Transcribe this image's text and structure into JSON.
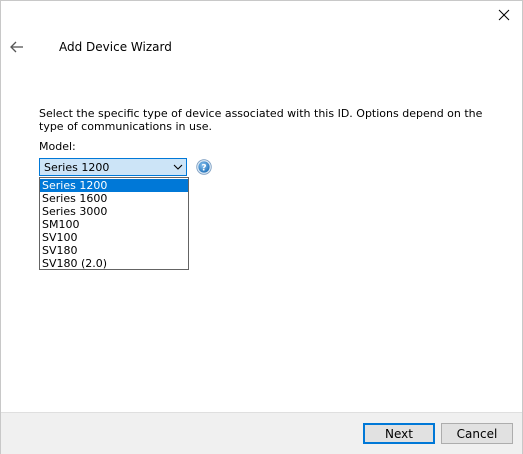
{
  "window": {
    "title": "Add Device Wizard"
  },
  "content": {
    "instructions": "Select the specific type of device associated with this ID. Options depend on the type of communications in use.",
    "model_label": "Model:",
    "model_select": {
      "value": "Series 1200",
      "options": [
        "Series 1200",
        "Series 1600",
        "Series 3000",
        "SM100",
        "SV100",
        "SV180",
        "SV180 (2.0)"
      ],
      "selected_index": 0
    }
  },
  "footer": {
    "next_label": "Next",
    "cancel_label": "Cancel"
  },
  "colors": {
    "accent": "#0078d7",
    "select_bg": "#cce4f7",
    "footer_bg": "#f0f0f0",
    "help_icon": "#1e6fb8"
  }
}
